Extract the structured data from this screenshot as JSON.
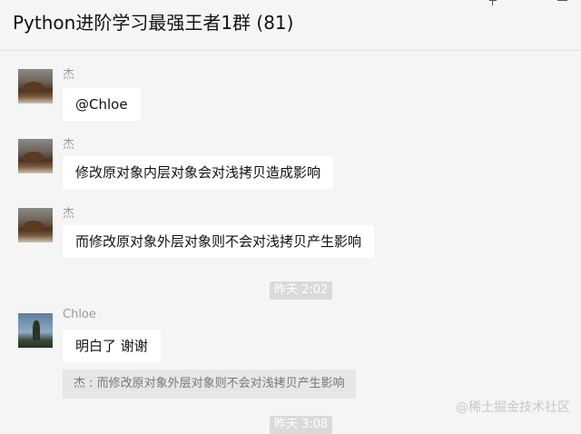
{
  "window": {
    "title": "Python进阶学习最强王者1群 (81)",
    "controls": [
      "pin-icon",
      "minimize-icon",
      "maximize-icon"
    ]
  },
  "messages": [
    {
      "sender": "杰",
      "text": "@Chloe"
    },
    {
      "sender": "杰",
      "text": "修改原对象内层对象会对浅拷贝造成影响"
    },
    {
      "sender": "杰",
      "text": "而修改原对象外层对象则不会对浅拷贝产生影响"
    },
    {
      "timestamp": "昨天 2:02"
    },
    {
      "sender": "Chloe",
      "text": "明白了 谢谢",
      "quote": "杰 : 而修改原对象外层对象则不会对浅拷贝产生影响"
    },
    {
      "timestamp": "昨天 3:08"
    }
  ],
  "watermark": "@稀土掘金技术社区"
}
